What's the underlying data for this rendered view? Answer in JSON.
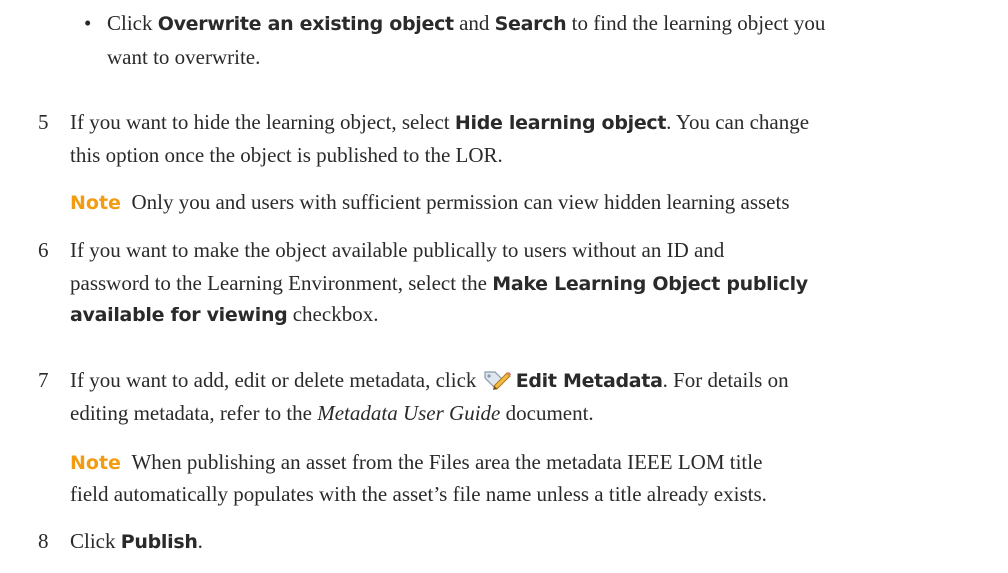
{
  "bullet": {
    "symbol": "•",
    "pre": "Click ",
    "bold1": "Overwrite an existing object",
    "mid": " and ",
    "bold2": "Search",
    "post": " to find the learning object you",
    "line2": "want to overwrite."
  },
  "steps": [
    {
      "number": "5",
      "line1_pre": "If you want to hide the learning object, select ",
      "line1_bold": "Hide learning object",
      "line1_post": ". You can change",
      "line2": "this option once the object is published to the LOR."
    },
    {
      "number": "6",
      "line1": "If you want to make the object available publically to users without an ID and",
      "line2_pre": "password to the Learning Environment, select the ",
      "line2_bold": "Make Learning Object publicly",
      "line3_bold": "available for viewing",
      "line3_post": " checkbox."
    },
    {
      "number": "7",
      "line1_pre": "If you want to add, edit or delete metadata, click ",
      "line1_bold": "Edit Metadata",
      "line1_post": ". For details on",
      "line2_pre": "editing metadata, refer to the ",
      "line2_italic": "Metadata User Guide",
      "line2_post": " document."
    },
    {
      "number": "8",
      "line1_pre": "Click ",
      "line1_bold": "Publish",
      "line1_post": "."
    }
  ],
  "notes": [
    {
      "label": "Note",
      "line1": "Only you and users with sufficient permission can view hidden learning assets"
    },
    {
      "label": "Note",
      "line1": "When publishing an asset from the Files area the metadata IEEE LOM title",
      "line2": "field automatically populates with the asset’s file name unless a title already exists."
    }
  ],
  "colors": {
    "note_label": "#f39c12",
    "text": "#2a2a2a"
  },
  "icons": {
    "edit_metadata": "edit-metadata-icon"
  }
}
